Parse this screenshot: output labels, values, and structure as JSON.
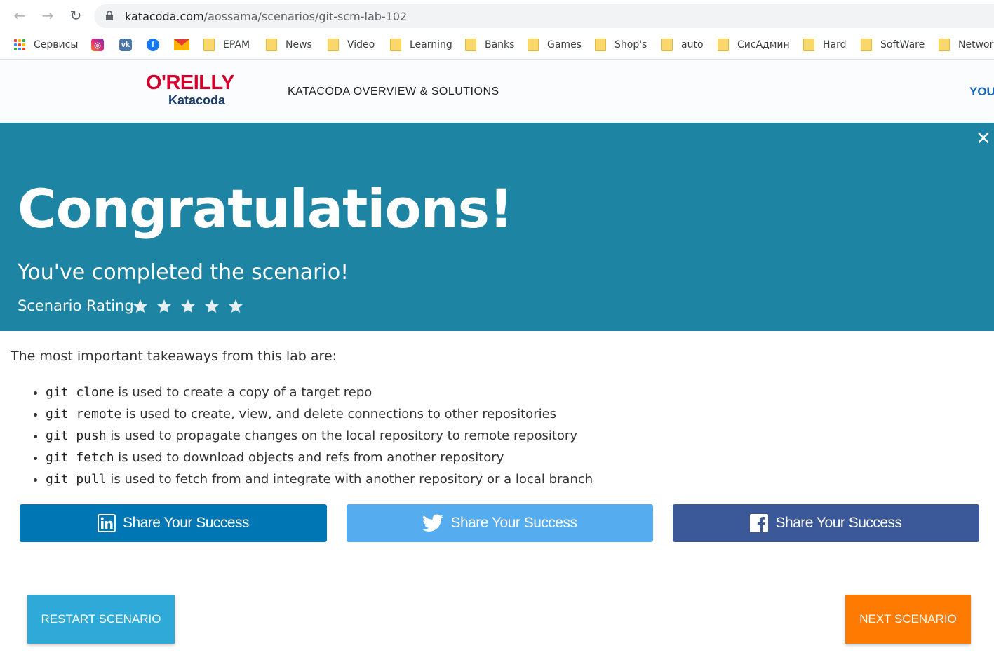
{
  "browser": {
    "url_host": "katacoda.com",
    "url_path": "/aossama/scenarios/git-scm-lab-102"
  },
  "bookmarks": {
    "apps_label": "Сервисы",
    "folders": [
      "EPAM",
      "News",
      "Video",
      "Learning",
      "Banks",
      "Games",
      "Shop's",
      "auto",
      "СисАдмин",
      "Hard",
      "SoftWare",
      "Networ"
    ]
  },
  "header": {
    "logo_top": "O'REILLY",
    "logo_bottom": "Katacoda",
    "nav_title": "KATACODA OVERVIEW & SOLUTIONS",
    "nav_right": "YOU"
  },
  "banner": {
    "title": "Congratulations!",
    "subtitle": "You've completed the scenario!",
    "rating_label": "Scenario Rating",
    "rating_stars": 5,
    "color": "#1e84a4"
  },
  "content": {
    "intro": "The most important takeaways from this lab are:",
    "items": [
      {
        "code": "git clone",
        "text": " is used to create a copy of a target repo"
      },
      {
        "code": "git remote",
        "text": " is used to create, view, and delete connections to other repositories"
      },
      {
        "code": "git push",
        "text": " is used to propagate changes on the local repository to remote repository"
      },
      {
        "code": "git fetch",
        "text": " is used to download objects and refs from another repository"
      },
      {
        "code": "git pull",
        "text": " is used to fetch from and integrate with another repository or a local branch"
      }
    ]
  },
  "share": {
    "linkedin_label": "Share Your Success",
    "twitter_label": "Share Your Success",
    "facebook_label": "Share Your Success"
  },
  "actions": {
    "restart_label": "RESTART SCENARIO",
    "next_label": "NEXT SCENARIO"
  }
}
